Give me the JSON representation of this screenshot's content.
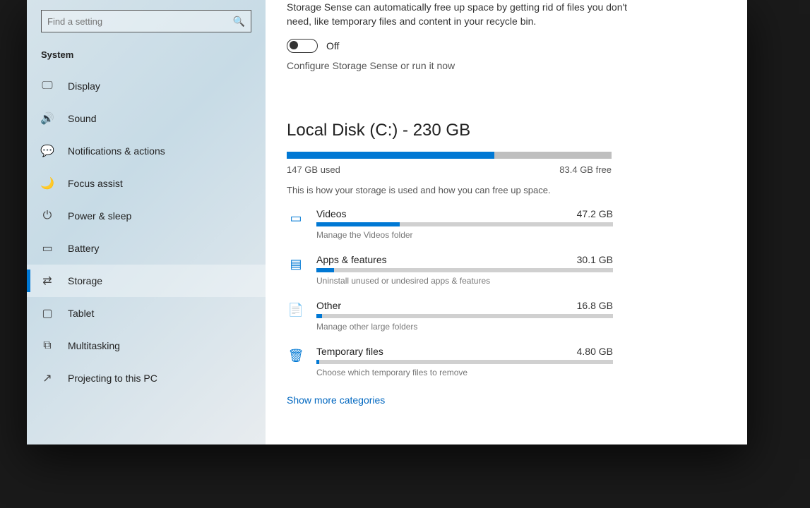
{
  "search": {
    "placeholder": "Find a setting"
  },
  "section_label": "System",
  "nav": [
    {
      "icon": "display-icon",
      "glyph": "🖵",
      "label": "Display"
    },
    {
      "icon": "sound-icon",
      "glyph": "🔊",
      "label": "Sound"
    },
    {
      "icon": "notify-icon",
      "glyph": "💬",
      "label": "Notifications & actions"
    },
    {
      "icon": "focus-icon",
      "glyph": "🌙",
      "label": "Focus assist"
    },
    {
      "icon": "power-icon",
      "glyph": "⏻",
      "label": "Power & sleep"
    },
    {
      "icon": "battery-icon",
      "glyph": "▭",
      "label": "Battery"
    },
    {
      "icon": "storage-icon",
      "glyph": "⇄",
      "label": "Storage",
      "selected": true
    },
    {
      "icon": "tablet-icon",
      "glyph": "▢",
      "label": "Tablet"
    },
    {
      "icon": "multi-icon",
      "glyph": "⧉",
      "label": "Multitasking"
    },
    {
      "icon": "project-icon",
      "glyph": "↗",
      "label": "Projecting to this PC"
    }
  ],
  "storage_sense": {
    "desc": "Storage Sense can automatically free up space by getting rid of files you don't need, like temporary files and content in your recycle bin.",
    "toggle_label": "Off",
    "configure": "Configure Storage Sense or run it now"
  },
  "disk": {
    "title": "Local Disk (C:) - 230 GB",
    "used_pct": 64,
    "used_label": "147 GB used",
    "free_label": "83.4 GB free",
    "hint": "This is how your storage is used and how you can free up space."
  },
  "categories": [
    {
      "icon": "video-icon",
      "glyph": "▭",
      "name": "Videos",
      "size": "47.2 GB",
      "pct": 28,
      "desc": "Manage the Videos folder"
    },
    {
      "icon": "apps-icon",
      "glyph": "▤",
      "name": "Apps & features",
      "size": "30.1 GB",
      "pct": 6,
      "desc": "Uninstall unused or undesired apps & features"
    },
    {
      "icon": "other-icon",
      "glyph": "📄",
      "name": "Other",
      "size": "16.8 GB",
      "pct": 2,
      "desc": "Manage other large folders"
    },
    {
      "icon": "temp-icon",
      "glyph": "🗑",
      "name": "Temporary files",
      "size": "4.80 GB",
      "pct": 1,
      "desc": "Choose which temporary files to remove"
    }
  ],
  "show_more": "Show more categories"
}
